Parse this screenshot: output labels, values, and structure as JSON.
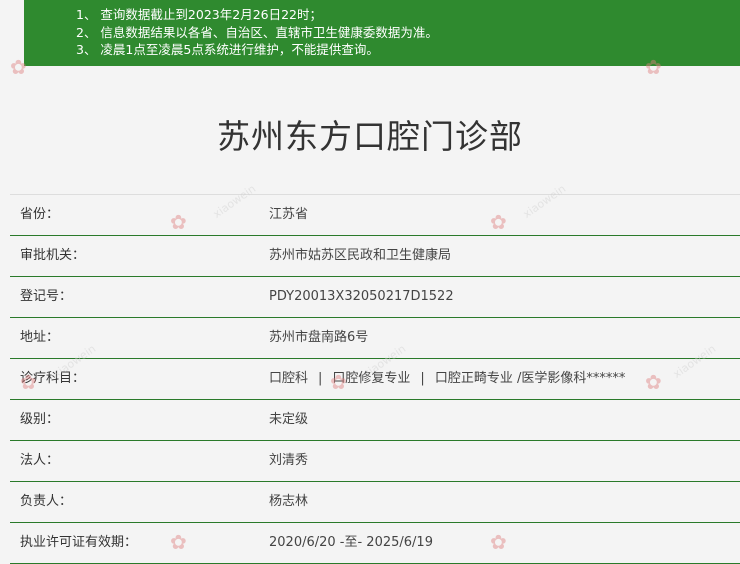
{
  "notice": {
    "items": [
      "1、 查询数据截止到2023年2月26日22时；",
      "2、 信息数据结果以各省、自治区、直辖市卫生健康委数据为准。",
      "3、 凌晨1点至凌晨5点系统进行维护，不能提供查询。"
    ]
  },
  "title": "苏州东方口腔门诊部",
  "rows": [
    {
      "label": "省份：",
      "value": "江苏省"
    },
    {
      "label": "审批机关：",
      "value": "苏州市姑苏区民政和卫生健康局"
    },
    {
      "label": "登记号：",
      "value": "PDY20013X32050217D1522"
    },
    {
      "label": "地址：",
      "value": "苏州市盘南路6号"
    },
    {
      "label": "诊疗科目：",
      "value": ""
    },
    {
      "label": "级别：",
      "value": "未定级"
    },
    {
      "label": "法人：",
      "value": "刘清秀"
    },
    {
      "label": "负责人：",
      "value": "杨志林"
    },
    {
      "label": "执业许可证有效期：",
      "value": "2020/6/20 -至- 2025/6/19"
    }
  ],
  "departments": {
    "items": [
      "口腔科",
      "口腔修复专业",
      "口腔正畸专业 /医学影像科******"
    ],
    "separator": "|"
  },
  "watermark": {
    "text": "xiaowein",
    "accent": "#e08080"
  },
  "colors": {
    "notice_bg": "#2f8a2f",
    "row_border": "#2a7a2a",
    "page_bg": "#f4f4f4"
  }
}
